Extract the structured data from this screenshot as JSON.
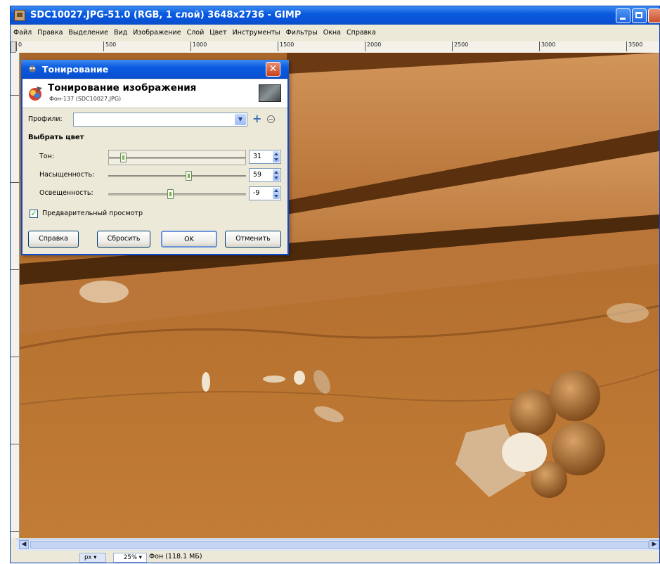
{
  "window": {
    "title": "SDC10027.JPG-51.0 (RGB, 1 слой) 3648x2736 - GIMP"
  },
  "menu": [
    "Файл",
    "Правка",
    "Выделение",
    "Вид",
    "Изображение",
    "Слой",
    "Цвет",
    "Инструменты",
    "Фильтры",
    "Окна",
    "Справка"
  ],
  "ruler": {
    "ticks": [
      "0",
      "500",
      "1000",
      "1500",
      "2000",
      "2500",
      "3000",
      "3500"
    ]
  },
  "status": {
    "unit": "px",
    "zoom": "25%",
    "text": "Фон (118.1 МБ)"
  },
  "dialog": {
    "title": "Тонирование",
    "header_title": "Тонирование изображения",
    "header_subtitle": "Фон-137 (SDC10027.JPG)",
    "profiles_label": "Профили:",
    "profiles_value": "",
    "section_label": "Выбрать цвет",
    "sliders": [
      {
        "label": "Тон:",
        "value": "31",
        "fraction": 0.09
      },
      {
        "label": "Насыщенность:",
        "value": "59",
        "fraction": 0.59
      },
      {
        "label": "Освещенность:",
        "value": "-9",
        "fraction": 0.45
      }
    ],
    "preview_label": "Предварительный просмотр",
    "preview_checked": true,
    "buttons": {
      "help": "Справка",
      "reset": "Сбросить",
      "ok": "OK",
      "cancel": "Отменить"
    }
  },
  "colors": {
    "titlebar": "#0a5be0",
    "sepia_mid": "#b8732e"
  }
}
